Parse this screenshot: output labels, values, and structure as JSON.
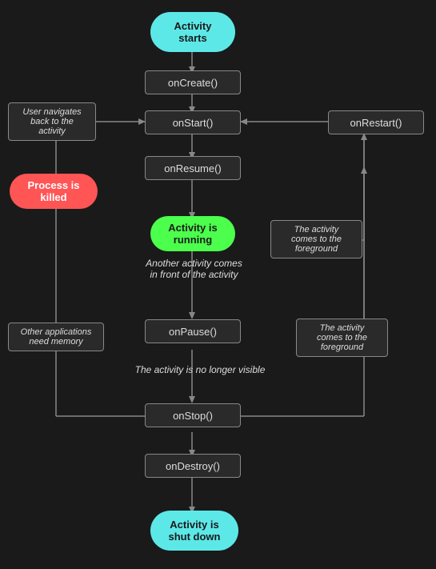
{
  "nodes": {
    "activity_starts": {
      "label": "Activity\nstarts"
    },
    "on_create": {
      "label": "onCreate()"
    },
    "on_start": {
      "label": "onStart()"
    },
    "on_restart": {
      "label": "onRestart()"
    },
    "on_resume": {
      "label": "onResume()"
    },
    "activity_running": {
      "label": "Activity is\nrunning"
    },
    "on_pause": {
      "label": "onPause()"
    },
    "on_stop": {
      "label": "onStop()"
    },
    "on_destroy": {
      "label": "onDestroy()"
    },
    "activity_shutdown": {
      "label": "Activity is\nshut down"
    },
    "process_killed": {
      "label": "Process is\nkilled"
    },
    "user_navigates": {
      "label": "User navigates\nback to the\nactivity"
    },
    "another_activity": {
      "label": "Another activity comes\nin front of the activity"
    },
    "activity_foreground1": {
      "label": "The activity\ncomes to the\nforeground"
    },
    "activity_foreground2": {
      "label": "The activity\ncomes to the\nforeground"
    },
    "no_longer_visible": {
      "label": "The activity is no longer visible"
    },
    "other_apps": {
      "label": "Other applications\nneed memory"
    }
  }
}
